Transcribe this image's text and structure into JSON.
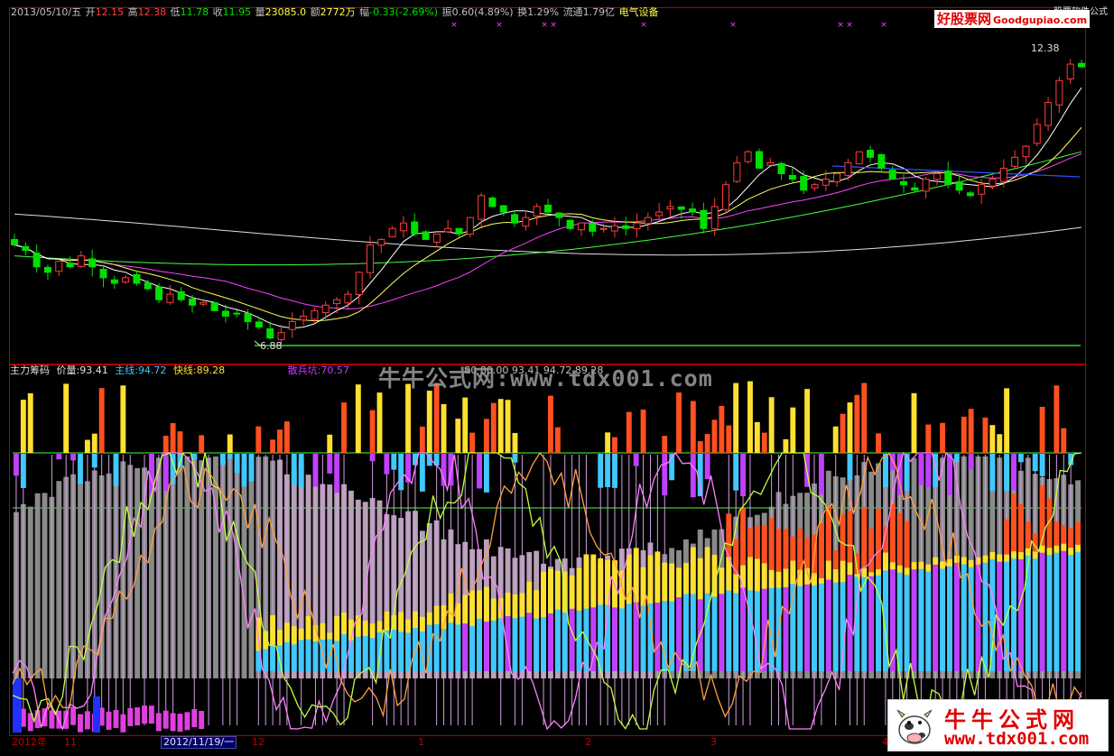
{
  "info_bar": {
    "date": "2013/05/10/五",
    "open_label": "开",
    "open": "12.15",
    "high_label": "高",
    "high": "12.38",
    "low_label": "低",
    "low": "11.78",
    "close_label": "收",
    "close": "11.95",
    "volume_label": "量",
    "volume": "23085.0",
    "amount_label": "额",
    "amount": "2772万",
    "change_label": "幅",
    "change": "-0.33(-2.69%)",
    "amplitude_label": "振",
    "amplitude": "0.60(4.89%)",
    "turnover_label": "换",
    "turnover": "1.29%",
    "float_label": "流通",
    "float": "1.79亿",
    "sector": "电气设备"
  },
  "price_panel": {
    "max_price_label": "12.38",
    "min_price_label": "6.88",
    "event_marker": "×"
  },
  "indicator_bar": {
    "name": "主力筹码",
    "price_label": "价量:",
    "price_value": "93.41",
    "main_label": "主线:",
    "main_value": "94.72",
    "fast_label": "快线:",
    "fast_value": "89.28",
    "retail_label": "散兵坑:",
    "retail_value": "70.57",
    "extra": "00  80.00  93.41  94.72  89.28"
  },
  "axis": {
    "year_label": "2012年",
    "m11": "11",
    "selected_date": "2012/11/19/一",
    "m12": "12",
    "m1": "1",
    "m2": "2",
    "m3": "3",
    "m4": "4"
  },
  "brand_top": {
    "logo_text": "好股票网",
    "domain": "Goodgupiao.com",
    "small_caption": "股票软件公式"
  },
  "brand_bottom": {
    "title": "牛牛公式网",
    "url": "www.tdx001.com"
  },
  "watermark": "牛牛公式网:www.tdx001.com",
  "colors": {
    "up": "#ff3b3b",
    "down": "#00e000",
    "ma5": "#ffffff",
    "ma10": "#ffff60",
    "ma20": "#ff40ff",
    "ma60": "#40ff40",
    "ma120": "#e0e0e0",
    "frame": "#b00000",
    "bar_orange": "#ff5020",
    "bar_yellow": "#ffe030",
    "bar_cyan": "#40c8ff",
    "bar_violet": "#c040ff",
    "bar_gray": "#a0a0a0",
    "line_orange": "#ffa040",
    "line_green": "#c0ff40",
    "line_pink": "#ff80ff"
  },
  "chart_data": {
    "type": "candlestick",
    "ylim": [
      6.88,
      12.38
    ],
    "max_label": "12.38",
    "min_label": "6.88",
    "candles_close": [
      8.7,
      8.6,
      8.3,
      8.2,
      8.4,
      8.3,
      8.5,
      8.3,
      8.1,
      8.0,
      8.1,
      8.0,
      7.9,
      7.7,
      7.8,
      7.7,
      7.6,
      7.65,
      7.5,
      7.4,
      7.45,
      7.3,
      7.2,
      7.0,
      7.1,
      7.3,
      7.4,
      7.5,
      7.6,
      7.7,
      7.8,
      8.2,
      8.7,
      8.8,
      9.0,
      9.1,
      8.9,
      8.8,
      8.9,
      9.0,
      8.9,
      9.2,
      9.6,
      9.4,
      9.3,
      9.1,
      9.2,
      9.4,
      9.3,
      9.2,
      9.0,
      9.1,
      8.95,
      9.0,
      9.05,
      9.0,
      9.1,
      9.2,
      9.3,
      9.4,
      9.35,
      9.3,
      9.0,
      9.4,
      9.8,
      10.2,
      10.4,
      10.1,
      10.2,
      10.0,
      9.9,
      9.7,
      9.8,
      9.9,
      10.0,
      10.2,
      10.4,
      10.3,
      10.1,
      9.9,
      9.8,
      9.7,
      9.9,
      10.0,
      9.8,
      9.7,
      9.6,
      9.8,
      9.9,
      10.1,
      10.3,
      10.5,
      10.9,
      11.3,
      11.7,
      12.0,
      11.95
    ]
  }
}
